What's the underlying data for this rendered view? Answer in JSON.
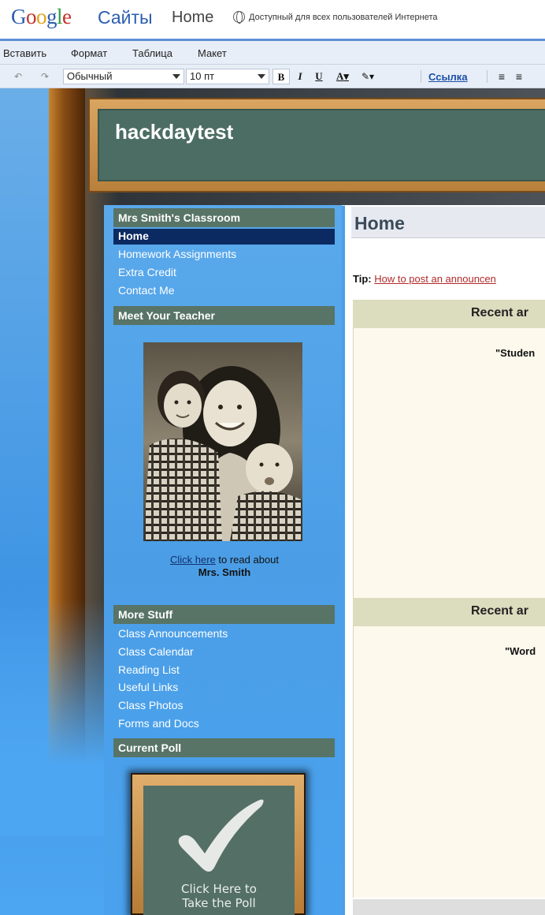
{
  "topbar": {
    "logo_text": "Google",
    "product": "Сайты",
    "page_name": "Home",
    "access_text": "Доступный для всех пользователей Интернета"
  },
  "menu": [
    "Вставить",
    "Формат",
    "Таблица",
    "Макет"
  ],
  "toolbar": {
    "style_value": "Обычный",
    "size_value": "10 пт",
    "bold": "B",
    "italic": "I",
    "underline": "U",
    "text_color": "A",
    "link_label": "Ссылка"
  },
  "site": {
    "title": "hackdaytest"
  },
  "sidebar": {
    "nav_heading": "Mrs Smith's Classroom",
    "nav_items": [
      "Home",
      "Homework Assignments",
      "Extra Credit",
      "Contact Me"
    ],
    "teacher_heading": "Meet Your Teacher",
    "caption_link": "Click here",
    "caption_text": " to read about",
    "caption_name": "Mrs. Smith",
    "more_heading": "More Stuff",
    "more_items": [
      "Class Announcements",
      "Class Calendar",
      "Reading List",
      "Useful Links",
      "Class Photos",
      "Forms and Docs"
    ],
    "poll_heading": "Current Poll",
    "poll_text_1": "Click Here to",
    "poll_text_2": "Take the Poll"
  },
  "main": {
    "page_title": "Home",
    "tip_label": "Tip:",
    "tip_link": "How to post an announcen",
    "panel1_title": "Recent ar",
    "panel1_quote": "\"Studen",
    "panel2_title": "Recent ar",
    "panel2_quote": "\"Word"
  },
  "colors": {
    "accent_blue": "#5d8fd6",
    "sidebar_heading": "#577466",
    "active_nav": "#0b2a62",
    "chalkboard": "#4c6d63",
    "panel_header": "#dcdcbf"
  }
}
